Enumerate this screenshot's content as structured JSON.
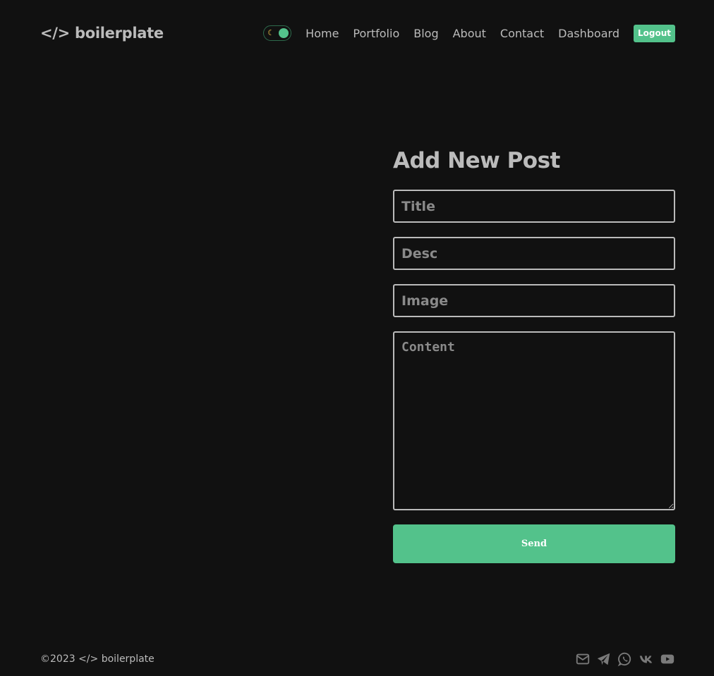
{
  "header": {
    "logo": "</> boilerplate",
    "theme_toggle_icon": "moon-icon",
    "nav": [
      {
        "label": "Home"
      },
      {
        "label": "Portfolio"
      },
      {
        "label": "Blog"
      },
      {
        "label": "About"
      },
      {
        "label": "Contact"
      },
      {
        "label": "Dashboard"
      }
    ],
    "logout_label": "Logout"
  },
  "form": {
    "title": "Add New Post",
    "title_placeholder": "Title",
    "desc_placeholder": "Desc",
    "image_placeholder": "Image",
    "content_placeholder": "Content",
    "send_label": "Send"
  },
  "footer": {
    "copyright": "©2023 </> boilerplate",
    "social_icons": [
      "mail-icon",
      "telegram-icon",
      "whatsapp-icon",
      "vk-icon",
      "youtube-icon"
    ]
  },
  "colors": {
    "background": "#111111",
    "text": "#bbbbbb",
    "accent": "#53c28b",
    "icon": "#7a7a7a"
  }
}
